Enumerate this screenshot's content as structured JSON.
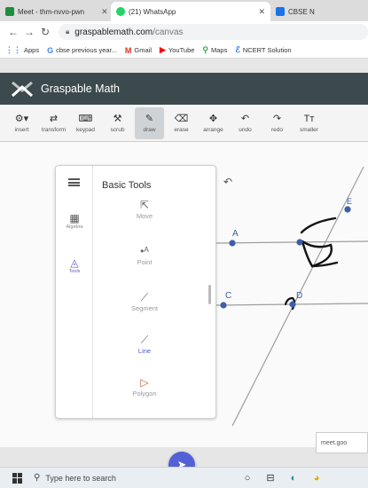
{
  "browser": {
    "tabs": [
      {
        "label": "Meet - thm-nvvo-pwn",
        "color": "#1e8e3e",
        "active": false
      },
      {
        "label": "(21) WhatsApp",
        "color": "#25d366",
        "active": true
      },
      {
        "label": "CBSE N",
        "color": "#1a73e8",
        "active": false
      }
    ],
    "url_domain": "graspablemath.com",
    "url_path": "/canvas",
    "bookmarks": [
      {
        "label": "Apps",
        "icon": "apps-grid-icon",
        "color": "#4285f4"
      },
      {
        "label": "cbse previous year...",
        "icon": "google-icon",
        "color": "#4285f4"
      },
      {
        "label": "Gmail",
        "icon": "gmail-icon",
        "color": "#d93025"
      },
      {
        "label": "YouTube",
        "icon": "youtube-icon",
        "color": "#ff0000"
      },
      {
        "label": "Maps",
        "icon": "maps-pin-icon",
        "color": "#34a853"
      },
      {
        "label": "NCERT Solution",
        "icon": "ncert-icon",
        "color": "#1a73e8"
      }
    ]
  },
  "app": {
    "title": "Graspable Math",
    "header_color": "#3d4a4d"
  },
  "toolbar": [
    {
      "label": "insert",
      "icon": "⚙▾"
    },
    {
      "label": "transform",
      "icon": "⇄"
    },
    {
      "label": "keypad",
      "icon": "⌨"
    },
    {
      "label": "scrub",
      "icon": "⚒"
    },
    {
      "label": "draw",
      "icon": "✎",
      "selected": true
    },
    {
      "label": "erase",
      "icon": "⌫"
    },
    {
      "label": "arrange",
      "icon": "✥"
    },
    {
      "label": "undo",
      "icon": "↶"
    },
    {
      "label": "redo",
      "icon": "↷"
    },
    {
      "label": "smaller",
      "icon": "Tт"
    }
  ],
  "panel": {
    "title": "Basic Tools",
    "nav": [
      {
        "label": "Algebra",
        "icon": "calculator-icon"
      },
      {
        "label": "Tools",
        "icon": "geometry-tools-icon",
        "active": true
      }
    ],
    "tools": [
      {
        "label": "Move",
        "glyph": "⇱"
      },
      {
        "label": "Point",
        "glyph": "•ᴬ"
      },
      {
        "label": "Segment",
        "glyph": "⟋"
      },
      {
        "label": "Line",
        "glyph": "⟋",
        "selected": true
      },
      {
        "label": "Polygon",
        "glyph": "▷"
      }
    ],
    "accent": "#5361d6"
  },
  "geometry": {
    "points": [
      "A",
      "C",
      "D",
      "E"
    ],
    "line_color": "#9e9e9e",
    "point_color": "#3b5fa8"
  },
  "notification": {
    "text": "meet.goo"
  },
  "taskbar": {
    "search_placeholder": "Type here to search"
  }
}
